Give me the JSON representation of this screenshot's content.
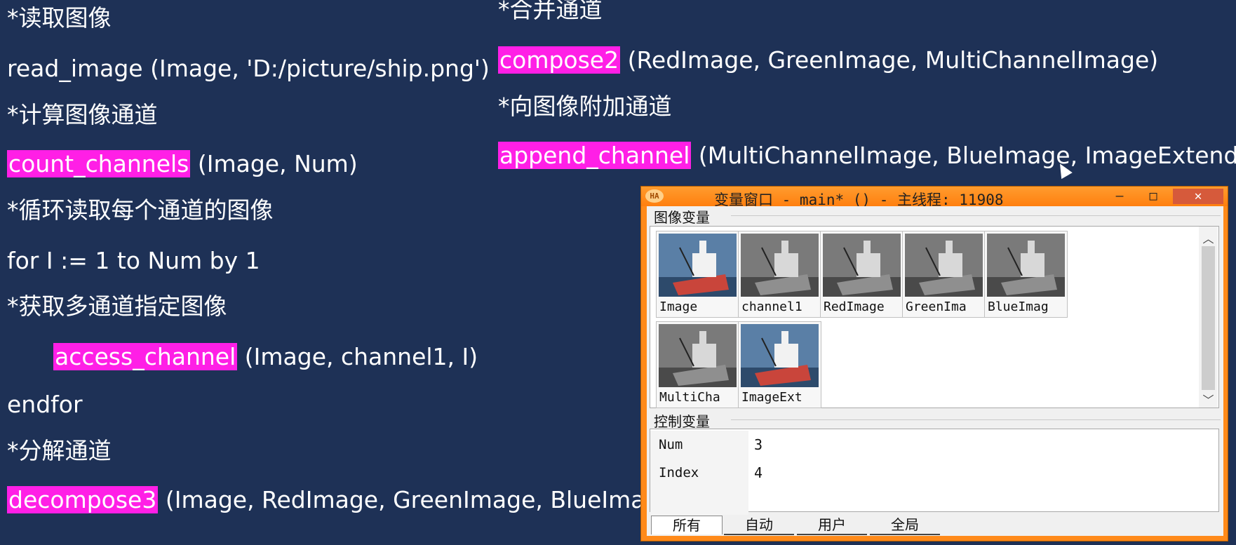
{
  "code": {
    "left": [
      {
        "text": "*读取图像"
      },
      {
        "text": "read_image (Image, 'D:/picture/ship.png')"
      },
      {
        "text": "*计算图像通道"
      },
      {
        "hl": "count_channels",
        "rest": " (Image, Num)"
      },
      {
        "text": "*循环读取每个通道的图像"
      },
      {
        "text": "for I := 1 to Num by 1"
      },
      {
        "text": "*获取多通道指定图像"
      },
      {
        "hl": "access_channel",
        "rest": " (Image, channel1, I)"
      },
      {
        "text": "endfor"
      },
      {
        "text": "*分解通道"
      },
      {
        "hl": "decompose3",
        "rest": " (Image, RedImage, GreenImage, BlueImage)"
      }
    ],
    "right": [
      {
        "text": "*合并通道"
      },
      {
        "hl": "compose2",
        "rest": " (RedImage,  GreenImage, MultiChannelImage)"
      },
      {
        "text": "*向图像附加通道"
      },
      {
        "hl": "append_channel",
        "rest": " (MultiChannelImage, BlueImage, ImageExtended)"
      }
    ]
  },
  "window": {
    "logo": "HA",
    "title": "变量窗口 - main* () - 主线程: 11908",
    "minimize": "—",
    "maximize": "□",
    "close": "✕",
    "image_section_label": "图像变量",
    "control_section_label": "控制变量",
    "images": [
      {
        "label": "Image",
        "kind": "color"
      },
      {
        "label": "channel1",
        "kind": "gray"
      },
      {
        "label": "RedImage",
        "kind": "gray"
      },
      {
        "label": "GreenIma",
        "kind": "gray"
      },
      {
        "label": "BlueImag",
        "kind": "gray"
      },
      {
        "label": "MultiCha",
        "kind": "gray"
      },
      {
        "label": "ImageExt",
        "kind": "color"
      }
    ],
    "controls": [
      {
        "name": "Num",
        "value": "3"
      },
      {
        "name": "Index",
        "value": "4"
      }
    ],
    "tabs": [
      "所有",
      "自动",
      "用户",
      "全局"
    ],
    "scroll_up": "︿",
    "scroll_down": "﹀"
  },
  "colors": {
    "background": "#1e3156",
    "highlight": "#ff1fe6",
    "window_frame": "#ff8a1a"
  }
}
